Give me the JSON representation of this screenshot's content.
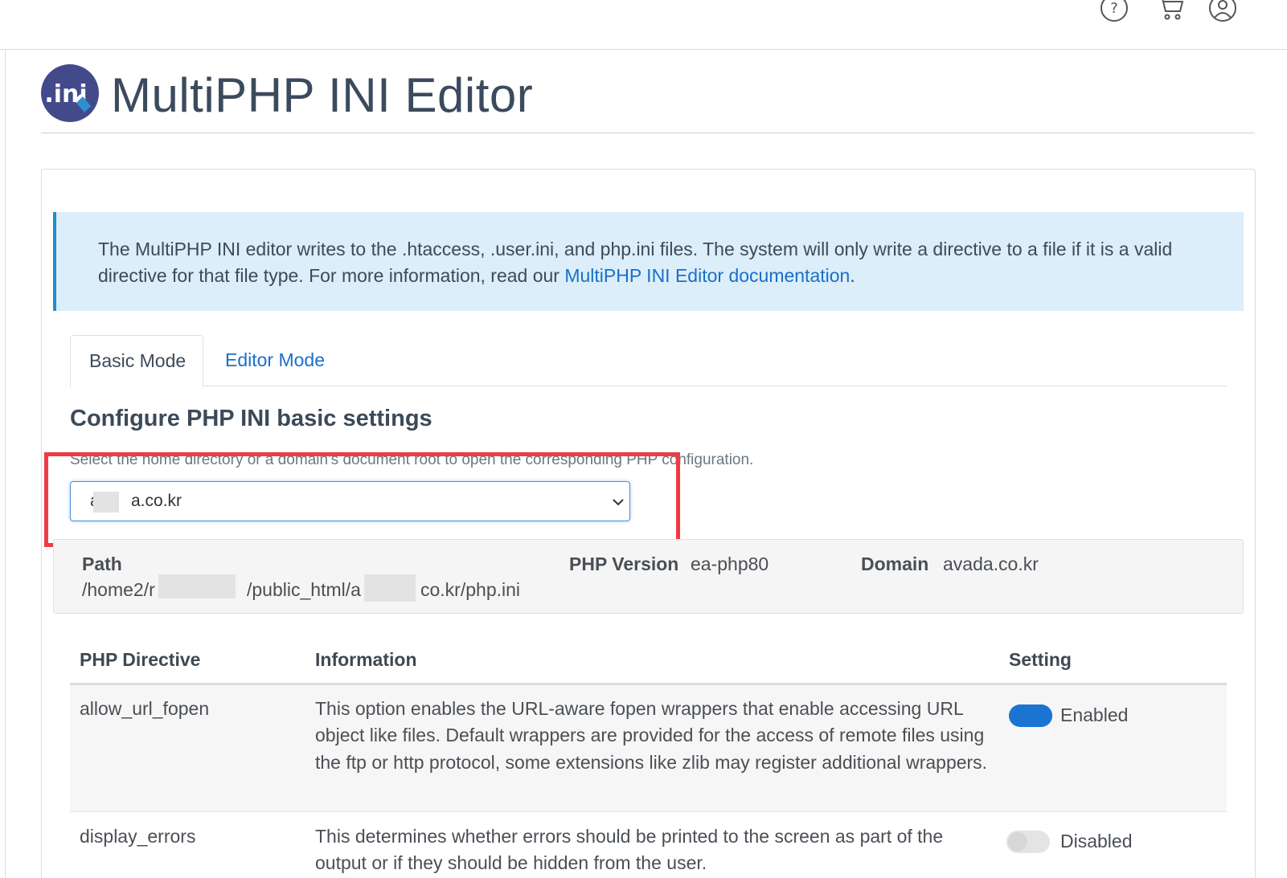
{
  "header": {
    "icons": [
      "help-icon",
      "cart-icon",
      "user-icon"
    ]
  },
  "page": {
    "title": "MultiPHP INI Editor",
    "logo_text": ".ini"
  },
  "alert": {
    "text": "The MultiPHP INI editor writes to the .htaccess, .user.ini, and php.ini files. The system will only write a directive to a file if it is a valid directive for that file type. For more information, read our ",
    "link_text": "MultiPHP INI Editor documentation",
    "suffix": "."
  },
  "tabs": [
    {
      "label": "Basic Mode",
      "active": true
    },
    {
      "label": "Editor Mode",
      "active": false
    }
  ],
  "section": {
    "title": "Configure PHP INI basic settings",
    "help": "Select the home directory or a domain's document root to open the corresponding PHP configuration."
  },
  "select": {
    "value_prefix": "a",
    "value_suffix": "a.co.kr"
  },
  "info": {
    "path_label": "Path",
    "path_part1": "/home2/r",
    "path_part2": "/public_html/a",
    "path_part3": "co.kr/php.ini",
    "version_label": "PHP Version",
    "version_value": "ea-php80",
    "domain_label": "Domain",
    "domain_value": "avada.co.kr"
  },
  "table": {
    "headers": [
      "PHP Directive",
      "Information",
      "Setting"
    ],
    "rows": [
      {
        "directive": "allow_url_fopen",
        "info": "This option enables the URL-aware fopen wrappers that enable accessing URL object like files. Default wrappers are provided for the access of remote files using the ftp or http protocol, some extensions like zlib may register additional wrappers.",
        "setting": "Enabled",
        "enabled": true
      },
      {
        "directive": "display_errors",
        "info": "This determines whether errors should be printed to the screen as part of the output or if they should be hidden from the user.",
        "setting": "Disabled",
        "enabled": false
      }
    ]
  },
  "colors": {
    "accent": "#1a6fc9",
    "alert_bg": "#dbeef9",
    "highlight": "#ee3b45",
    "toggle_on": "#1b74d1"
  }
}
